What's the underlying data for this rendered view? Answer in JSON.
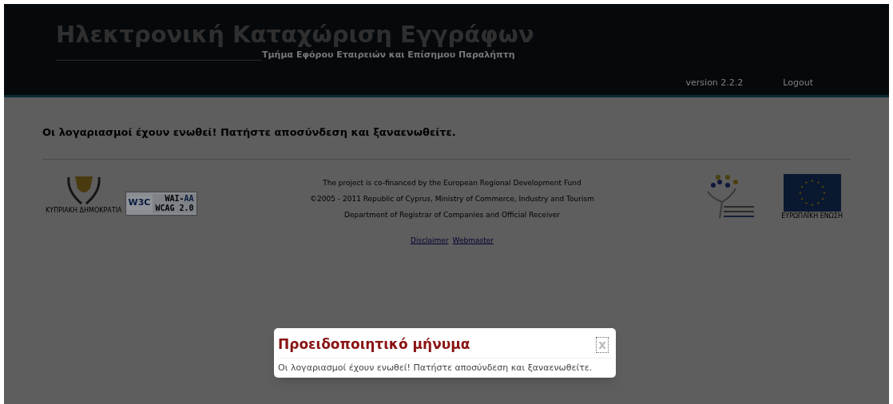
{
  "header": {
    "title": "Ηλεκτρονική Καταχώριση Εγγράφων",
    "subtitle": "Τμήμα Εφόρου Εταιρειών και Επίσημου Παραλήπτη",
    "version": "version 2.2.2",
    "logout": "Logout"
  },
  "message": "Οι λογαριασμοί έχουν ενωθεί! Πατήστε αποσύνδεση και ξαναενωθείτε.",
  "footer": {
    "left_logos": {
      "cyprus_caption": "ΚΥΠΡΙΑΚΗ ΔΗΜΟΚΡΑΤΙΑ",
      "w3c": "W3C",
      "wai_prefix": "WAI-",
      "wai_level": "AA",
      "wcag": "WCAG 2.0"
    },
    "lines": [
      "The project is co-financed by the European Regional Development Fund",
      "©2005 - 2011 Republic of Cyprus, Ministry of Commerce, Industry and Tourism",
      "Department of Registrar of Companies and Official Receiver"
    ],
    "links": [
      "Disclaimer",
      "Webmaster"
    ],
    "eu_caption": "ΕΥΡΩΠΑΪΚΗ ΕΝΩΣΗ"
  },
  "dialog": {
    "title": "Προειδοποιητικό μήνυμα",
    "close": "x",
    "body": "Οι λογαριασμοί έχουν ενωθεί! Πατήστε αποσύνδεση και ξαναενωθείτε."
  }
}
